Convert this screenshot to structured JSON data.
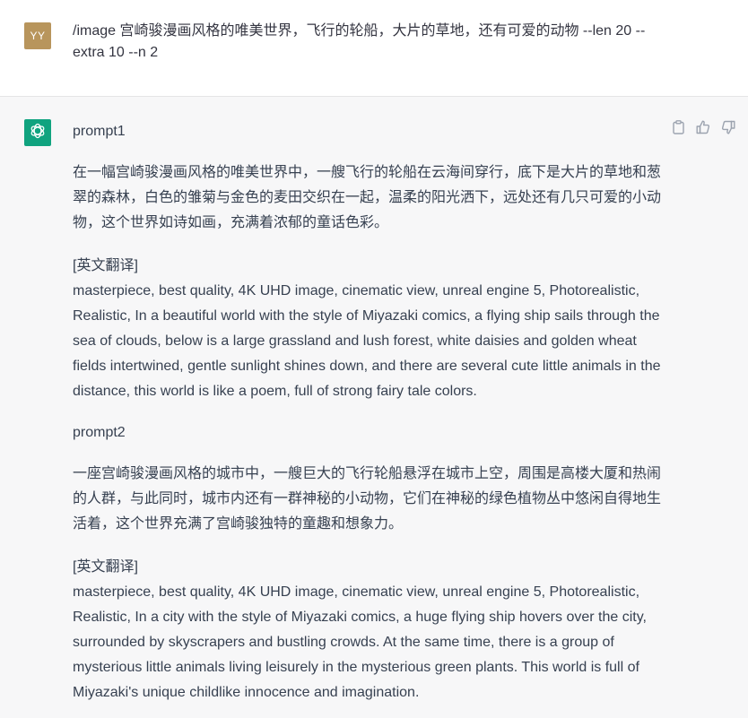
{
  "user": {
    "avatar_initials": "YY",
    "avatar_color": "#b8955c",
    "message": "/image 宫崎骏漫画风格的唯美世界，飞行的轮船，大片的草地，还有可爱的动物 --len 20 --extra 10 --n 2"
  },
  "assistant": {
    "avatar_icon": "openai-logo-icon",
    "avatar_color": "#10a37f",
    "actions": [
      {
        "name": "copy-icon"
      },
      {
        "name": "thumbs-up-icon"
      },
      {
        "name": "thumbs-down-icon"
      }
    ],
    "prompts": [
      {
        "title": "prompt1",
        "chinese": "在一幅宫崎骏漫画风格的唯美世界中，一艘飞行的轮船在云海间穿行，底下是大片的草地和葱翠的森林，白色的雏菊与金色的麦田交织在一起，温柔的阳光洒下，远处还有几只可爱的小动物，这个世界如诗如画，充满着浓郁的童话色彩。",
        "translation_label": "[英文翻译]",
        "english": "masterpiece, best quality, 4K UHD image, cinematic view, unreal engine 5, Photorealistic, Realistic, In a beautiful world with the style of Miyazaki comics, a flying ship sails through the sea of clouds, below is a large grassland and lush forest, white daisies and golden wheat fields intertwined, gentle sunlight shines down, and there are several cute little animals in the distance, this world is like a poem, full of strong fairy tale colors."
      },
      {
        "title": "prompt2",
        "chinese": "一座宫崎骏漫画风格的城市中，一艘巨大的飞行轮船悬浮在城市上空，周围是高楼大厦和热闹的人群，与此同时，城市内还有一群神秘的小动物，它们在神秘的绿色植物丛中悠闲自得地生活着，这个世界充满了宫崎骏独特的童趣和想象力。",
        "translation_label": "[英文翻译]",
        "english": "masterpiece, best quality, 4K UHD image, cinematic view, unreal engine 5, Photorealistic, Realistic, In a city with the style of Miyazaki comics, a huge flying ship hovers over the city, surrounded by skyscrapers and bustling crowds. At the same time, there is a group of mysterious little animals living leisurely in the mysterious green plants. This world is full of Miyazaki's unique childlike innocence and imagination."
      }
    ]
  }
}
